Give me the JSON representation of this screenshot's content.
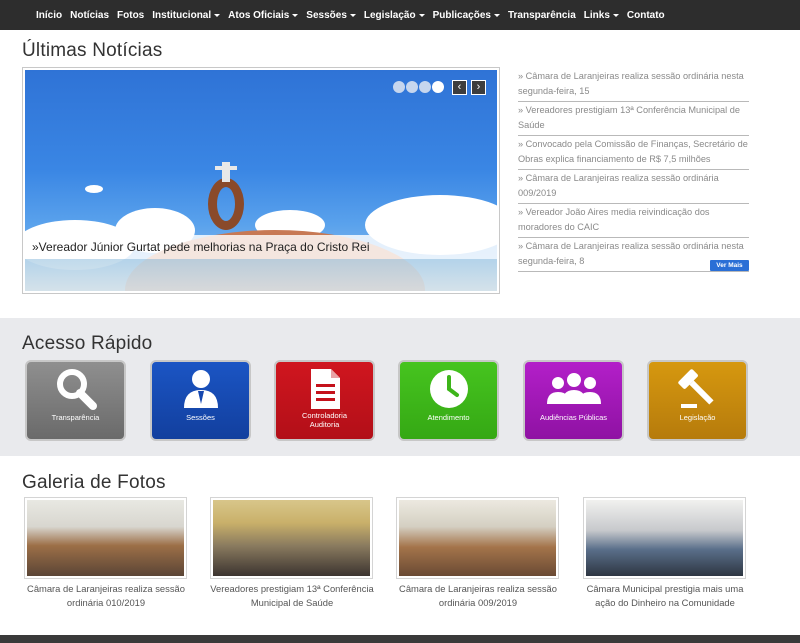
{
  "nav": {
    "items": [
      {
        "label": "Início",
        "dropdown": false
      },
      {
        "label": "Notícias",
        "dropdown": false
      },
      {
        "label": "Fotos",
        "dropdown": false
      },
      {
        "label": "Institucional",
        "dropdown": true
      },
      {
        "label": "Atos Oficiais",
        "dropdown": true
      },
      {
        "label": "Sessões",
        "dropdown": true
      },
      {
        "label": "Legislação",
        "dropdown": true
      },
      {
        "label": "Publicações",
        "dropdown": true
      },
      {
        "label": "Transparência",
        "dropdown": false
      },
      {
        "label": "Links",
        "dropdown": true
      },
      {
        "label": "Contato",
        "dropdown": false
      }
    ]
  },
  "news": {
    "title": "Últimas Notícias",
    "slide_caption": "»Vereador Júnior Gurtat pede melhorias na Praça do Cristo Rei",
    "prev_label": "‹",
    "next_label": "›",
    "items": [
      "» Câmara de Laranjeiras realiza sessão ordinária nesta segunda-feira, 15",
      "» Vereadores prestigiam 13ª Conferência Municipal de Saúde",
      "» Convocado pela Comissão de Finanças, Secretário de Obras explica financiamento de R$ 7,5 milhões",
      "» Câmara de Laranjeiras realiza sessão ordinária 009/2019",
      "» Vereador João Aires media reivindicação dos moradores do CAIC",
      "» Câmara de Laranjeiras realiza sessão ordinária nesta segunda-feira, 8"
    ],
    "more_label": "Ver Mais"
  },
  "quick_access": {
    "title": "Acesso Rápido",
    "tiles": [
      {
        "label": "Transparência",
        "icon": "search-icon",
        "color": "#7d7d7d"
      },
      {
        "label": "Sessões",
        "icon": "user-icon",
        "color": "#1547b0"
      },
      {
        "label": "Controladoria\nAuditoria",
        "icon": "document-icon",
        "color": "#c4111b"
      },
      {
        "label": "Atendimento",
        "icon": "clock-icon",
        "color": "#3db51a"
      },
      {
        "label": "Audiências Públicas",
        "icon": "group-icon",
        "color": "#a319b8"
      },
      {
        "label": "Legislação",
        "icon": "gavel-icon",
        "color": "#c98c12"
      }
    ]
  },
  "gallery": {
    "title": "Galeria de Fotos",
    "photos": [
      {
        "caption": "Câmara de Laranjeiras realiza sessão ordinária 010/2019"
      },
      {
        "caption": "Vereadores prestigiam 13ª Conferência Municipal de Saúde"
      },
      {
        "caption": "Câmara de Laranjeiras realiza sessão ordinária 009/2019"
      },
      {
        "caption": "Câmara Municipal prestigia mais uma ação do Dinheiro na Comunidade"
      }
    ]
  }
}
